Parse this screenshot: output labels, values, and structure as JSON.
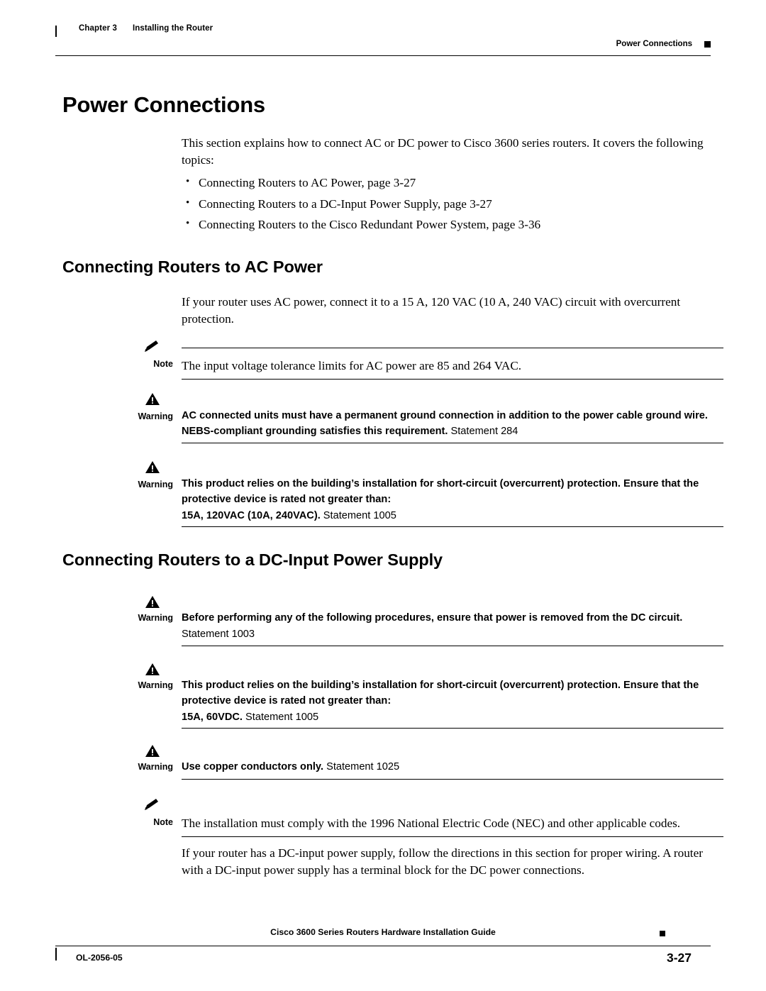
{
  "header": {
    "chapter_num": "Chapter 3",
    "chapter_title": "Installing the Router",
    "running_head": "Power Connections"
  },
  "title": "Power Connections",
  "intro": "This section explains how to connect AC or DC power to Cisco 3600 series routers. It covers the following topics:",
  "bullets": [
    "Connecting Routers to AC Power, page 3-27",
    "Connecting Routers to a DC-Input Power Supply, page 3-27",
    "Connecting Routers to the Cisco Redundant Power System, page 3-36"
  ],
  "sections": {
    "ac_heading": "Connecting Routers to AC Power",
    "ac_para": "If your router uses AC power, connect it to a 15 A, 120 VAC (10 A, 240 VAC) circuit with overcurrent protection.",
    "dc_heading": "Connecting Routers to a DC-Input Power Supply"
  },
  "notices": [
    {
      "label": "Note",
      "icon": "note-pencil-icon",
      "text": "The input voltage tolerance limits for AC power are 85 and 264 VAC."
    },
    {
      "label": "Warning",
      "icon": "warning-triangle-icon",
      "bold": "AC connected units must have a permanent ground connection in addition to the power cable ground wire. NEBS-compliant grounding satisfies this requirement.",
      "statement": " Statement 284"
    },
    {
      "label": "Warning",
      "icon": "warning-triangle-icon",
      "bold": "This product relies on the building’s installation for short-circuit (overcurrent) protection. Ensure that the protective device is rated not greater than:",
      "bold2": "15A, 120VAC (10A, 240VAC).",
      "statement": " Statement 1005"
    },
    {
      "label": "Warning",
      "icon": "warning-triangle-icon",
      "bold": "Before performing any of the following procedures, ensure that power is removed from the DC circuit.",
      "statement": "Statement 1003"
    },
    {
      "label": "Warning",
      "icon": "warning-triangle-icon",
      "bold": "This product relies on the building’s installation for short-circuit (overcurrent) protection. Ensure that the protective device is rated not greater than:",
      "bold2": "15A, 60VDC.",
      "statement": " Statement 1005"
    },
    {
      "label": "Warning",
      "icon": "warning-triangle-icon",
      "bold": "Use copper conductors only.",
      "statement": " Statement 1025"
    },
    {
      "label": "Note",
      "icon": "note-pencil-icon",
      "text": "The installation must comply with the 1996 National Electric Code (NEC) and other applicable codes."
    }
  ],
  "closing": "If your router has a DC-input power supply, follow the directions in this section for proper wiring. A router with a DC-input power supply has a terminal block for the DC power connections.",
  "footer": {
    "center": "Cisco 3600 Series Routers Hardware Installation Guide",
    "doc_id": "OL-2056-05",
    "page": "3-27"
  }
}
